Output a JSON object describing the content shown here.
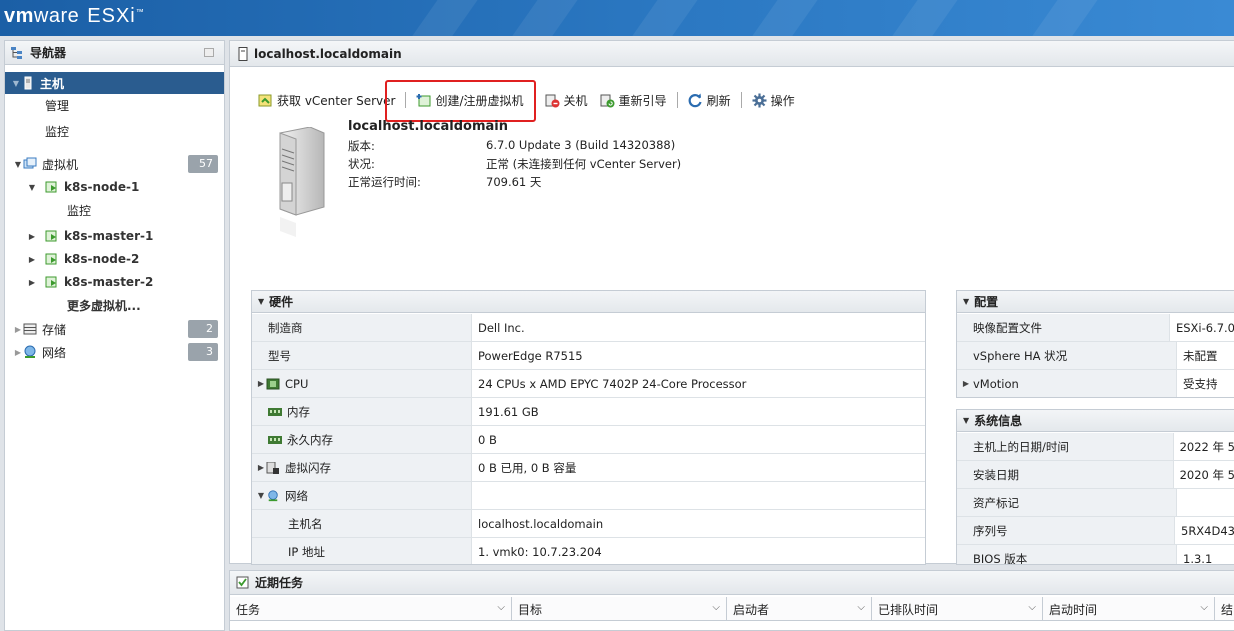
{
  "brand": {
    "vm": "vm",
    "ware": "ware",
    "product": "ESXi",
    "tm": "™"
  },
  "navigator": {
    "title": "导航器",
    "items": [
      {
        "label": "主机"
      },
      {
        "label": "管理"
      },
      {
        "label": "监控"
      },
      {
        "label": "虚拟机",
        "badge": "57"
      },
      {
        "label": "k8s-node-1"
      },
      {
        "label": "监控"
      },
      {
        "label": "k8s-master-1"
      },
      {
        "label": "k8s-node-2"
      },
      {
        "label": "k8s-master-2"
      },
      {
        "label": "更多虚拟机..."
      },
      {
        "label": "存储",
        "badge": "2"
      },
      {
        "label": "网络",
        "badge": "3"
      }
    ]
  },
  "main": {
    "title": "localhost.localdomain",
    "toolbar": {
      "vcenter": "获取 vCenter Server",
      "create_vm": "创建/注册虚拟机",
      "shutdown": "关机",
      "reboot": "重新引导",
      "refresh": "刷新",
      "actions": "操作"
    },
    "host": {
      "name": "localhost.localdomain",
      "version_label": "版本:",
      "version_value": "6.7.0 Update 3 (Build 14320388)",
      "status_label": "状况:",
      "status_value": "正常 (未连接到任何 vCenter Server)",
      "uptime_label": "正常运行时间:",
      "uptime_value": "709.61 天"
    }
  },
  "hardware": {
    "title": "硬件",
    "rows": [
      {
        "key": "制造商",
        "value": "Dell Inc."
      },
      {
        "key": "型号",
        "value": "PowerEdge R7515"
      },
      {
        "key": "CPU",
        "value": "24 CPUs x AMD EPYC 7402P 24-Core Processor"
      },
      {
        "key": "内存",
        "value": "191.61 GB"
      },
      {
        "key": "永久内存",
        "value": "0 B"
      },
      {
        "key": "虚拟闪存",
        "value": "0 B 已用, 0 B 容量"
      },
      {
        "key": "网络",
        "value": ""
      },
      {
        "key": "主机名",
        "value": "localhost.localdomain"
      },
      {
        "key": "IP 地址",
        "value": "1. vmk0: 10.7.23.204"
      }
    ]
  },
  "config": {
    "title": "配置",
    "rows": [
      {
        "key": "映像配置文件",
        "value": "ESXi-6.7.0"
      },
      {
        "key": "vSphere HA 状况",
        "value": "未配置"
      },
      {
        "key": "vMotion",
        "value": "受支持"
      }
    ]
  },
  "sysinfo": {
    "title": "系统信息",
    "rows": [
      {
        "key": "主机上的日期/时间",
        "value": "2022 年 5"
      },
      {
        "key": "安装日期",
        "value": "2020 年 5"
      },
      {
        "key": "资产标记",
        "value": ""
      },
      {
        "key": "序列号",
        "value": "5RX4D43"
      },
      {
        "key": "BIOS 版本",
        "value": "1.3.1"
      }
    ]
  },
  "tasks": {
    "title": "近期任务",
    "columns": [
      "任务",
      "目标",
      "启动者",
      "已排队时间",
      "启动时间",
      "结"
    ]
  },
  "colors": {
    "banner": "#1b5fa6",
    "selected": "#2a5c8f",
    "highlight": "#e02020"
  }
}
